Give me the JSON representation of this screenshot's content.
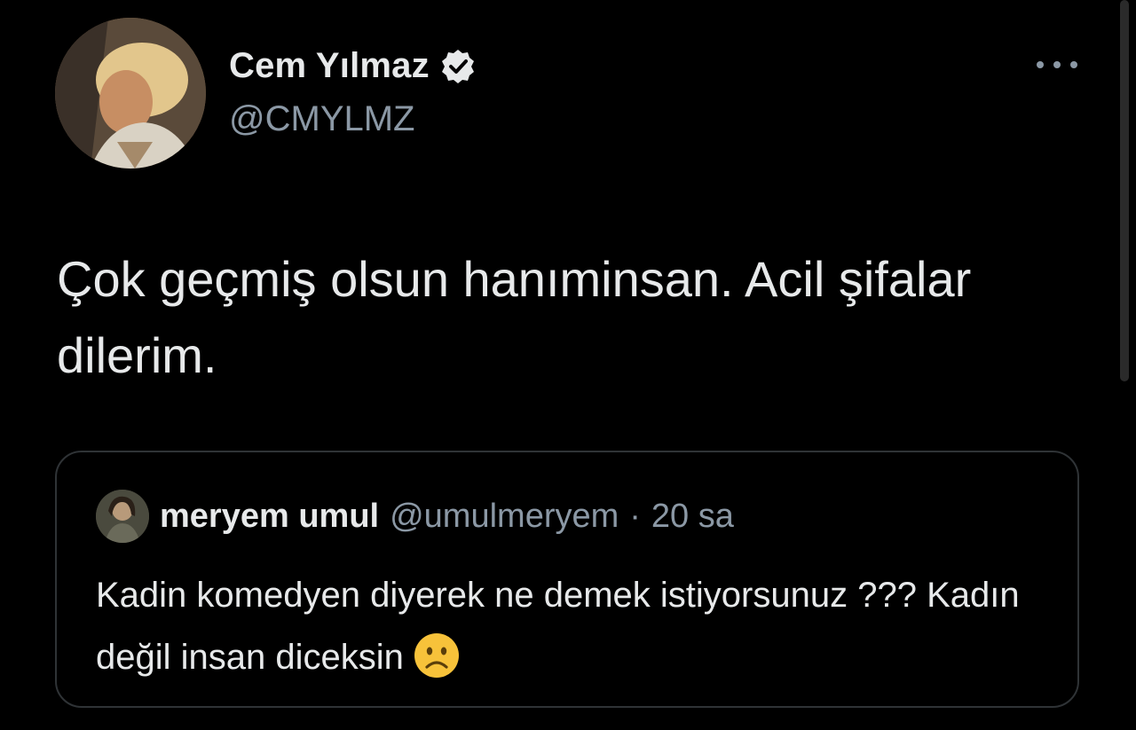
{
  "author": {
    "display_name": "Cem Yılmaz",
    "handle": "@CMYLMZ",
    "verified_icon": "verified-badge-icon"
  },
  "tweet": {
    "text": "Çok geçmiş olsun hanıminsan. Acil şifalar dilerim."
  },
  "quoted_tweet": {
    "display_name": "meryem umul",
    "handle": "@umulmeryem",
    "separator": "·",
    "time": "20 sa",
    "text": "Kadin komedyen diyerek ne demek istiyorsunuz ??? Kadın değil insan diceksin",
    "emoji_icon": "frowning-face-icon"
  },
  "icons": {
    "more": "more-options-icon"
  },
  "colors": {
    "background": "#000000",
    "text_primary": "#e7e9ea",
    "text_secondary": "#8b98a5",
    "border": "#2f3336",
    "emoji": "#f7c23a"
  }
}
